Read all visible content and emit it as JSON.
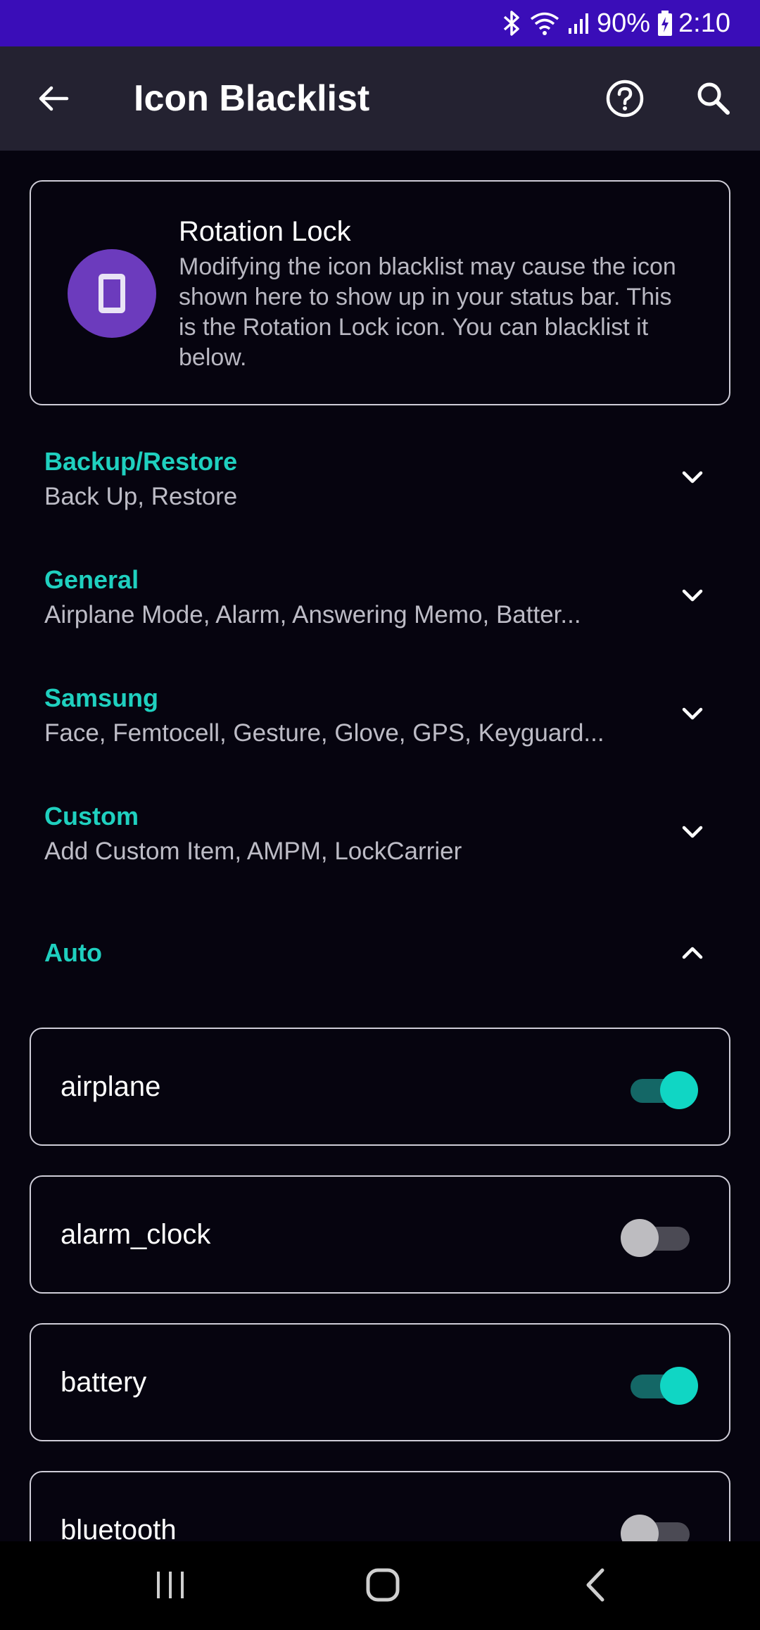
{
  "status_bar": {
    "battery": "90%",
    "time": "2:10",
    "icons": [
      "bluetooth-icon",
      "wifi-icon",
      "signal-icon",
      "battery-charging-icon"
    ]
  },
  "app_bar": {
    "title": "Icon Blacklist",
    "icons": [
      "back-arrow-icon",
      "help-icon",
      "search-icon"
    ]
  },
  "info_card": {
    "title": "Rotation Lock",
    "description": "Modifying the icon blacklist may cause the icon shown here to show up in your status bar. This is the Rotation Lock icon. You can blacklist it below.",
    "icon": "phone-rotation-icon",
    "icon_color": "#6c3bbd"
  },
  "sections": [
    {
      "title": "Backup/Restore",
      "subtitle": "Back Up, Restore",
      "expanded": false
    },
    {
      "title": "General",
      "subtitle": "Airplane Mode, Alarm, Answering Memo, Batter...",
      "expanded": false
    },
    {
      "title": "Samsung",
      "subtitle": "Face, Femtocell, Gesture, Glove, GPS, Keyguard...",
      "expanded": false
    },
    {
      "title": "Custom",
      "subtitle": "Add Custom Item, AMPM, LockCarrier",
      "expanded": false
    },
    {
      "title": "Auto",
      "subtitle": "",
      "expanded": true
    }
  ],
  "auto_items": [
    {
      "label": "airplane",
      "checked": true
    },
    {
      "label": "alarm_clock",
      "checked": false
    },
    {
      "label": "battery",
      "checked": true
    },
    {
      "label": "bluetooth",
      "checked": false
    }
  ],
  "colors": {
    "accent": "#1fd0bf",
    "status_bar_bg": "#3a0db8",
    "app_bar_bg": "#242231",
    "background": "#06040f",
    "switch_on": "#10d6c4"
  },
  "nav_bar": {
    "icons": [
      "recent-apps-icon",
      "home-icon",
      "back-icon"
    ]
  }
}
